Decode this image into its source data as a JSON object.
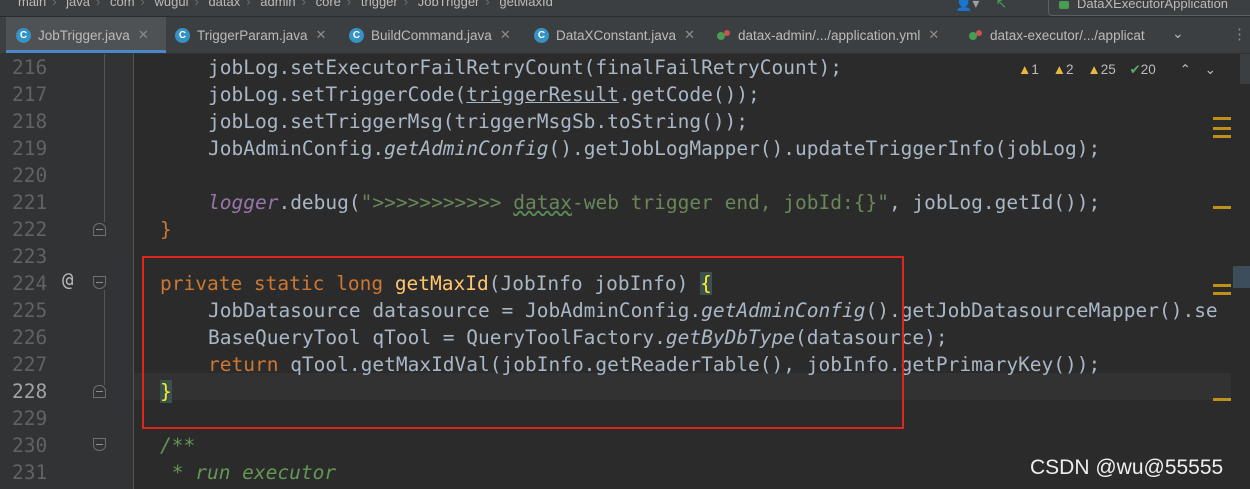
{
  "breadcrumb": [
    "main",
    "java",
    "com",
    "wugui",
    "datax",
    "admin",
    "core",
    "trigger",
    "JobTrigger",
    "getMaxId"
  ],
  "run_config": {
    "label": "DataXExecutorApplication"
  },
  "tabs": [
    {
      "label": "JobTrigger.java",
      "icon": "java-class-icon",
      "active": true,
      "closable": true
    },
    {
      "label": "TriggerParam.java",
      "icon": "java-class-icon",
      "closable": true
    },
    {
      "label": "BuildCommand.java",
      "icon": "java-class-icon",
      "closable": true
    },
    {
      "label": "DataXConstant.java",
      "icon": "java-class-icon",
      "closable": true
    },
    {
      "label": "datax-admin/.../application.yml",
      "icon": "yaml-file-icon",
      "closable": true
    },
    {
      "label": "datax-executor/.../applicat",
      "icon": "yaml-file-icon"
    }
  ],
  "inspections": {
    "warn1": "1",
    "warn2": "2",
    "warn3": "25",
    "ok": "20"
  },
  "line_numbers": [
    "216",
    "217",
    "218",
    "219",
    "220",
    "221",
    "222",
    "223",
    "224",
    "225",
    "226",
    "227",
    "228",
    "229",
    "230",
    "231"
  ],
  "current_line": "228",
  "code": {
    "l216": [
      "jobLog.setExecutorFailRetryCount(finalFailRetryCount);"
    ],
    "l217": [
      "jobLog.setTriggerCode(",
      "triggerResult",
      ".getCode());"
    ],
    "l218": [
      "jobLog.setTriggerMsg(triggerMsgSb.toString());"
    ],
    "l219": [
      "JobAdminConfig.",
      "getAdminConfig",
      "().getJobLogMapper().updateTriggerInfo(jobLog);"
    ],
    "l221": [
      "logger",
      ".debug(",
      "\">>>>>>>>>>> ",
      "datax",
      "-web trigger end, jobId:{}\"",
      ", jobLog.getId());"
    ],
    "l222": [
      "}"
    ],
    "l224": [
      "private static long ",
      "getMaxId",
      "(JobInfo jobInfo) ",
      "{"
    ],
    "l225": [
      "JobDatasource datasource = JobAdminConfig.",
      "getAdminConfig",
      "().getJobDatasourceMapper().se"
    ],
    "l226": [
      "BaseQueryTool qTool = QueryToolFactory.",
      "getByDbType",
      "(datasource);"
    ],
    "l227": [
      "return ",
      "qTool.getMaxIdVal(jobInfo.getReaderTable(), jobInfo.getPrimaryKey());"
    ],
    "l228": [
      "}"
    ],
    "l230": [
      "/**"
    ],
    "l231": [
      " * run executor"
    ]
  },
  "watermark": "CSDN @wu@55555",
  "colors": {
    "keyword": "#cc7832",
    "method": "#ffc66d",
    "static": "#9876aa",
    "string": "#6a8759",
    "comment": "#629755",
    "highlight_box": "#e0251f"
  }
}
